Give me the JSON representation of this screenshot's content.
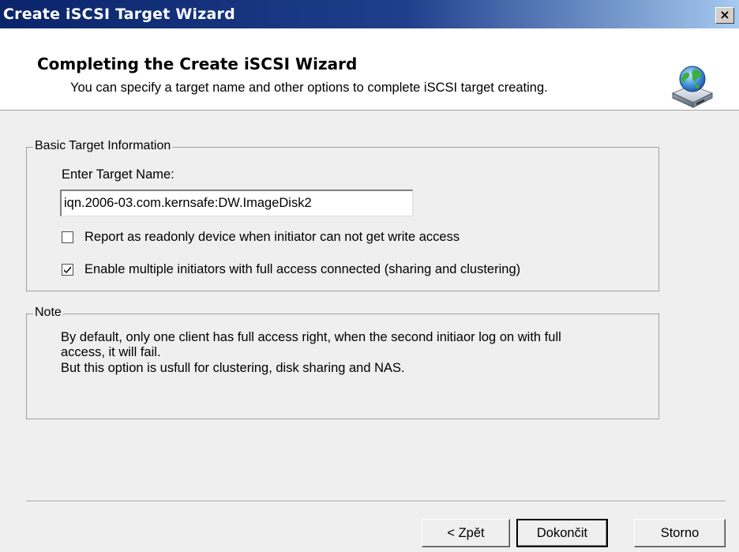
{
  "window": {
    "title": "Create iSCSI Target Wizard",
    "close_glyph": "×"
  },
  "header": {
    "heading": "Completing the Create iSCSI Wizard",
    "subheading": "You can specify a target name and other options to complete iSCSI target creating.",
    "icon": "disk-globe-icon"
  },
  "basic_info": {
    "legend": "Basic Target Information",
    "target_name_label": "Enter Target Name:",
    "target_name_value": "iqn.2006-03.com.kernsafe:DW.ImageDisk2",
    "readonly_option": {
      "label": "Report as readonly device when initiator can not get write access",
      "checked": false
    },
    "multi_initiator_option": {
      "label": "Enable multiple initiators with  full access connected (sharing and clustering)",
      "checked": true
    }
  },
  "note": {
    "legend": "Note",
    "line1": "By default, only one client has full access right, when the second initiaor log on with full",
    "line2": "access, it will fail.",
    "line3": "But this option is usfull for clustering, disk sharing and NAS."
  },
  "buttons": {
    "back": "< Zpět",
    "finish": "Dokončit",
    "cancel": "Storno"
  },
  "colors": {
    "titlebar_start": "#0a246a",
    "titlebar_end": "#a6caf0",
    "dialog_bg": "#efefef"
  }
}
